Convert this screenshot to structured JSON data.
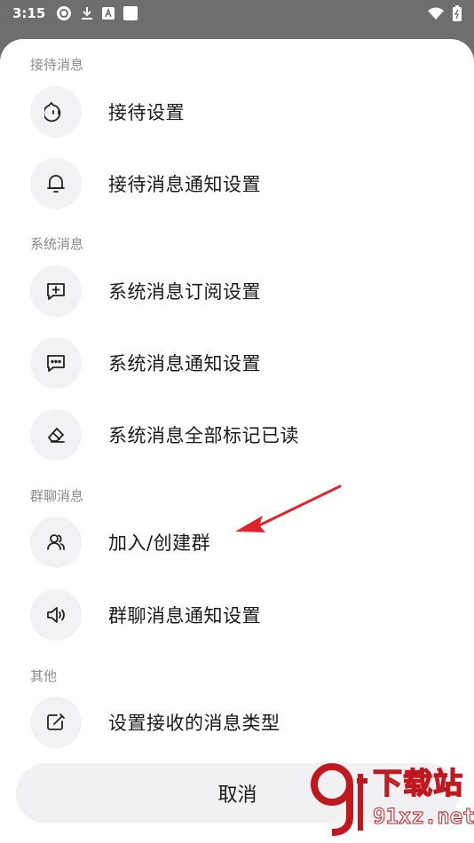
{
  "status_bar": {
    "time": "3:15"
  },
  "sections": [
    {
      "title": "接待消息",
      "items": [
        {
          "label": "接待设置",
          "icon": "smile-face-icon"
        },
        {
          "label": "接待消息通知设置",
          "icon": "bell-icon"
        }
      ]
    },
    {
      "title": "系统消息",
      "items": [
        {
          "label": "系统消息订阅设置",
          "icon": "chat-plus-icon"
        },
        {
          "label": "系统消息通知设置",
          "icon": "chat-dots-icon"
        },
        {
          "label": "系统消息全部标记已读",
          "icon": "eraser-icon"
        }
      ]
    },
    {
      "title": "群聊消息",
      "items": [
        {
          "label": "加入/创建群",
          "icon": "users-icon"
        },
        {
          "label": "群聊消息通知设置",
          "icon": "speaker-icon"
        }
      ]
    },
    {
      "title": "其他",
      "items": [
        {
          "label": "设置接收的消息类型",
          "icon": "edit-square-icon"
        }
      ]
    }
  ],
  "cancel_label": "取消",
  "watermark": {
    "logo_text": "9f",
    "big_text": "下载站",
    "small_text": "91xz.net"
  },
  "colors": {
    "accent_red": "#e0242b",
    "icon_bg": "#f2f2f4"
  }
}
